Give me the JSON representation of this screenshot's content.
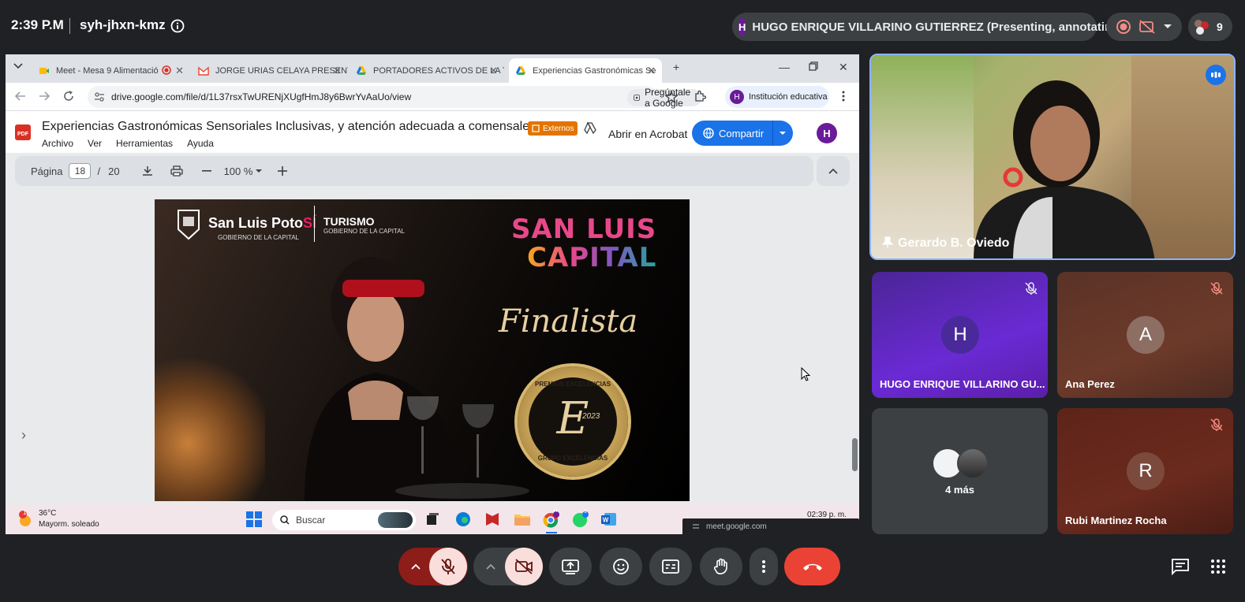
{
  "meet": {
    "time": "2:39 P.M",
    "meeting_code": "syh-jhxn-kmz",
    "presenter_initial": "H",
    "presenter_label": "HUGO ENRIQUE VILLARINO GUTIERREZ (Presenting, annotating)",
    "participant_count": "9"
  },
  "browser": {
    "tabs": [
      {
        "label": "Meet - Mesa 9 Alimentació"
      },
      {
        "label": "JORGE URIAS CELAYA PRESENT"
      },
      {
        "label": "PORTADORES ACTIVOS DE LA T"
      },
      {
        "label": "Experiencias Gastronómicas Se"
      }
    ],
    "url": "drive.google.com/file/d/1L37rsxTwURENjXUgfHmJ8y6BwrYvAaUo/view",
    "ask_google": "Pregúntale a Google",
    "profile_initial": "H",
    "profile_label": "Institución educativa"
  },
  "pdf": {
    "title": "Experiencias Gastronómicas Sensoriales Inclusivas, y atención adecuada a comensales...",
    "menu": [
      "Archivo",
      "Ver",
      "Herramientas",
      "Ayuda"
    ],
    "badge": "Externos",
    "open_acrobat": "Abrir en Acrobat",
    "share": "Compartir",
    "avatar": "H",
    "page_label": "Página",
    "page_current": "18",
    "page_sep": "/",
    "page_total": "20",
    "zoom": "100 %"
  },
  "slide": {
    "brand_left": "San Luis Poto",
    "brand_left_suffix": "SÍ",
    "brand_left_sub": "GOBIERNO DE LA CAPITAL",
    "brand_right": "TURISMO",
    "brand_right_sub": "GOBIERNO DE LA CAPITAL",
    "logo_line1": "SAN LUIS",
    "logo_line2": "CAPITAL",
    "finalista": "Finalista",
    "seal_top": "PREMIOS EXCELENCIAS",
    "seal_bottom": "GRUPO EXCELENCIAS",
    "seal_letter": "E",
    "seal_year": "2023"
  },
  "taskbar": {
    "weather_badge": "1",
    "temperature": "36°C",
    "weather_desc": "Mayorm. soleado",
    "search_placeholder": "Buscar",
    "clock": "02:39 p. m.",
    "tooltip": "meet.google.com",
    "chrome_badge": "H",
    "whatsapp_badge": "1"
  },
  "participants": {
    "featured": {
      "name": "Gerardo B. Oviedo"
    },
    "tiles": [
      {
        "initial": "H",
        "name": "HUGO ENRIQUE VILLARINO GU..."
      },
      {
        "initial": "A",
        "name": "Ana Perez"
      },
      {
        "name": "4 más"
      },
      {
        "initial": "R",
        "name": "Rubi Martinez Rocha"
      }
    ]
  },
  "colors": {
    "meet_bg": "#202124",
    "end_call": "#ea4335",
    "share_blue": "#1a73e8",
    "hugo_tile": "#5b1ea8",
    "ana_tile": "#6d3a2a",
    "rubi_tile": "#6b2a1e"
  }
}
